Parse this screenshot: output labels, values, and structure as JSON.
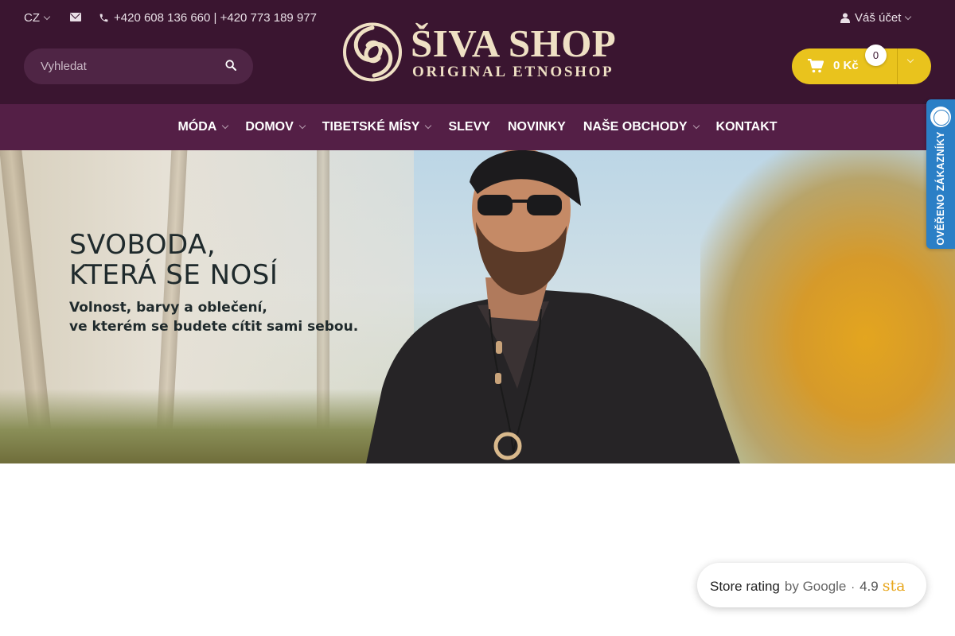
{
  "header": {
    "language": "CZ",
    "phone": "+420 608 136 660 | +420 773 189 977",
    "search_placeholder": "Vyhledat",
    "logo_title": "ŠIVA SHOP",
    "logo_subtitle": "ORIGINAL ETNOSHOP",
    "account_label": "Váš účet",
    "cart_total": "0 Kč",
    "cart_count": "0"
  },
  "nav": {
    "items": [
      {
        "label": "MÓDA",
        "dropdown": true
      },
      {
        "label": "DOMOV",
        "dropdown": true
      },
      {
        "label": "TIBETSKÉ MÍSY",
        "dropdown": true
      },
      {
        "label": "SLEVY",
        "dropdown": false
      },
      {
        "label": "NOVINKY",
        "dropdown": false
      },
      {
        "label": "NAŠE OBCHODY",
        "dropdown": true
      },
      {
        "label": "KONTAKT",
        "dropdown": false
      }
    ]
  },
  "hero": {
    "title_line1": "SVOBODA,",
    "title_line2": "KTERÁ SE NOSÍ",
    "subtitle_line1": "Volnost, barvy a oblečení,",
    "subtitle_line2": "ve kterém se budete cítit sami sebou."
  },
  "verified_badge": {
    "label": "OVĚŘENO ZÁKAZNÍKY"
  },
  "rating_widget": {
    "store": "Store rating",
    "by": "by Google",
    "separator": "·",
    "score": "4.9",
    "stars_text": "sta"
  },
  "colors": {
    "header_bg": "#3a1530",
    "nav_bg": "#541f46",
    "cart_yellow": "#e9c31d",
    "logo_cream": "#efe0c4",
    "badge_blue": "#2b7fc6",
    "star_orange": "#e8a61b"
  },
  "icons": {
    "mail": "envelope-icon",
    "phone": "phone-icon",
    "search": "search-icon",
    "account": "user-icon",
    "cart": "shopping-cart-icon"
  }
}
